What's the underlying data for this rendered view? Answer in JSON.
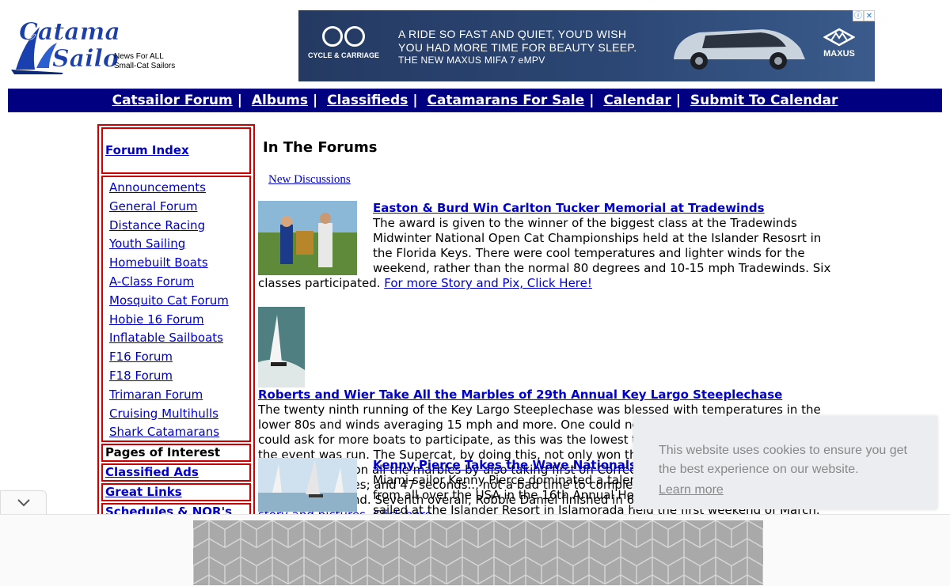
{
  "header": {
    "logo_line1": "Catamaran",
    "logo_line2": "Sailor",
    "tagline1": "News For ALL",
    "tagline2": "Small-Cat Sailors"
  },
  "ad": {
    "brand_left": "CYCLE & CARRIAGE",
    "line1": "A RIDE SO FAST AND QUIET, YOU'D WISH",
    "line2": "YOU HAD MORE TIME FOR BEAUTY SLEEP.",
    "line3": "THE NEW MAXUS MIFA 7 eMPV",
    "brand_right": "MAXUS",
    "info_icon": "info-icon",
    "close_icon": "close-icon"
  },
  "nav": {
    "items": [
      "Catsailor Forum",
      "Albums",
      "Classifieds",
      "Catamarans For Sale",
      "Calendar",
      "Submit To Calendar"
    ],
    "separator": "|"
  },
  "sidebar": {
    "forum_index": "Forum Index",
    "forums": [
      "Announcements",
      "General Forum",
      "Distance Racing",
      "Youth Sailing",
      "Homebuilt Boats",
      "A-Class Forum",
      "Mosquito Cat Forum",
      "Hobie 16 Forum",
      "Inflatable Sailboats",
      "F16 Forum",
      "F18 Forum",
      "Trimaran Forum",
      "Cruising Multihulls",
      "Shark Catamarans"
    ],
    "pages_of_interest": "Pages of Interest",
    "classified_ads": "Classified Ads",
    "great_links": "Great Links",
    "schedules": "Schedules & NOR's"
  },
  "main": {
    "heading": "In The Forums",
    "new_discussions": "New Discussions",
    "articles": [
      {
        "title": "Easton & Burd Win Carlton Tucker Memorial at Tradewinds",
        "body": "The award is given to the winner of the biggest class at the Tradewinds Midwinter National Open Cat Championships held at the Islander Resosrt in the Florida Keys. There were cool temperatures and lighter winds for the weekend, rather than the normal 80 degrees and 10-15 mph Tradewinds. Six classes participated. ",
        "link": "For more Story and Pix, Click Here!"
      },
      {
        "title": "Roberts and Wier Take All the Marbles of 29th Annual Key Largo Steeplechase",
        "body": "The twenty ninth running of the Key Largo Steeplechase was blessed with temperatures in the lower 80s and winds averaging 15 mph and more. One could not ask for any more than that. One could ask for more boats to participate, as this was the lowest turnout since the very first time the event was run. The Supercat, by doing this, not only won the first to finish with the fastest time, but also won all the marbles by also taking first on Corrected time. Their overall time was 6 hours; 26 minutes; and 47 seconds.., not a bad time to complete a 110-mile sail. However, it did not set the recond. Seventh overall, Robbie Daniel finished in 6 hours; thirteen minutes. ",
        "link": "For full story and pictures, Click here"
      },
      {
        "title": "Kenny Pierce Takes the Wave Nationals in the Keys",
        "body": "Miami sailor Kenny Pierce dominated a talent-laden fleet of Hobie Wave sailors from all over the USA in the 16th Annual Hobie Wave National Championship, sailed at the Islander Resort in Islamorada held the first weekend of March.",
        "link": ""
      }
    ]
  },
  "cookie": {
    "message": "This website uses cookies to ensure you get the best experience on our website.",
    "learn_more": "Learn more"
  },
  "bottom": {
    "collapse_icon": "chevron-down-icon"
  }
}
